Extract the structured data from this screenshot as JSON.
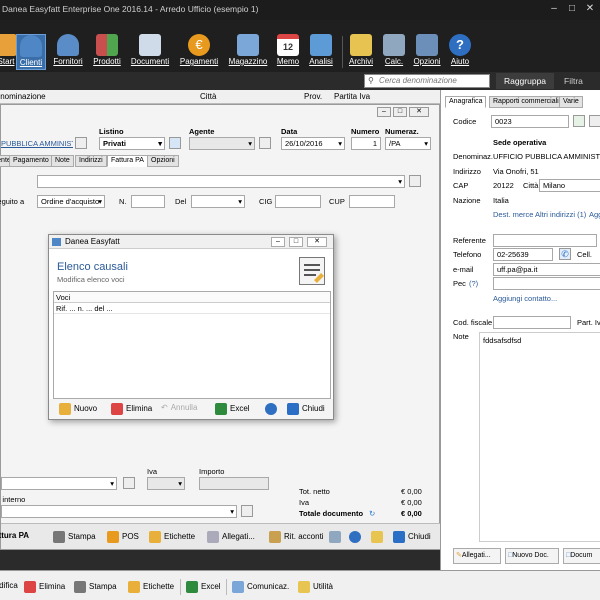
{
  "window": {
    "title": "Danea Easyfatt Enterprise One  2016.14  - Arredo Ufficio (esempio 1)"
  },
  "toolbar": {
    "items": [
      {
        "label": "Start",
        "color": "#e8a13a"
      },
      {
        "label": "Clienti",
        "color": "#4f86c6"
      },
      {
        "label": "Fornitori",
        "color": "#4f86c6"
      },
      {
        "label": "Prodotti",
        "color": "#c94f4f"
      },
      {
        "label": "Documenti",
        "color": "#9fb8d8"
      },
      {
        "label": "Pagamenti",
        "color": "#e89a1e"
      },
      {
        "label": "Magazzino",
        "color": "#7aa6d8"
      },
      {
        "label": "Memo",
        "color": "#d8d8d8"
      },
      {
        "label": "Analisi",
        "color": "#5d9bd6"
      },
      {
        "label": "Archivi",
        "color": "#e7c451"
      },
      {
        "label": "Calc.",
        "color": "#8fa8bf"
      },
      {
        "label": "Opzioni",
        "color": "#6b8fb8"
      },
      {
        "label": "Aiuto",
        "color": "#2f6fc2"
      }
    ],
    "memo_day": "12"
  },
  "search": {
    "placeholder": "Cerca denominazione",
    "group_label": "Raggruppa",
    "filter_label": "Filtra"
  },
  "list_columns": [
    "Denominazione",
    "Città",
    "Prov.",
    "Partita Iva"
  ],
  "edit": {
    "cliente_link": "PUBBLICA AMMINISTRAZIONE",
    "listino_label": "Listino",
    "listino_value": "Privati",
    "agente_label": "Agente",
    "data_label": "Data",
    "data_value": "26/10/2016",
    "numero_label": "Numero",
    "numero_value": "1",
    "numeraz_label": "Numeraz.",
    "numeraz_value": "/PA",
    "tabs": [
      "Cliente",
      "Pagamento",
      "Note",
      "Indirizzi",
      "Fattura PA",
      "Opzioni"
    ],
    "seguito_label": "A seguito a",
    "seguito_value": "Ordine d'acquisto",
    "n_label": "N.",
    "del_label": "Del",
    "cig_label": "CIG",
    "cup_label": "CUP",
    "iva_label": "Iva",
    "importo_label": "Importo",
    "uso_label": "Uso interno",
    "tot_netto_label": "Tot. netto",
    "tot_netto_value": "€ 0,00",
    "iva_tot_label": "Iva",
    "iva_tot_value": "€ 0,00",
    "tot_doc_label": "Totale documento",
    "tot_doc_value": "€ 0,00",
    "bottom_buttons": [
      "Invia fattura PA",
      "Stampa",
      "POS",
      "Etichette",
      "Allegati...",
      "Rit. acconti",
      "",
      "",
      "",
      "Chiudi"
    ]
  },
  "dialog": {
    "title": "Danea Easyfatt",
    "heading": "Elenco causali",
    "subheading": "Modifica elenco voci",
    "list_header": "Voci",
    "rows": [
      "Rif. ... n. ... del ..."
    ],
    "buttons": {
      "new": "Nuovo",
      "delete": "Elimina",
      "undo": "Annulla",
      "excel": "Excel",
      "close": "Chiudi"
    }
  },
  "right": {
    "tabs": [
      "Anagrafica",
      "Rapporti commerciali",
      "Varie"
    ],
    "codice_label": "Codice",
    "codice_value": "0023",
    "sede_label": "Sede operativa",
    "denom_label": "Denominaz.",
    "denom_value": "UFFICIO PUBBLICA AMMINISTRAZIONE",
    "indirizzo_label": "Indirizzo",
    "indirizzo_value": "Via Onofri, 51",
    "cap_label": "CAP",
    "cap_value": "20122",
    "citta_label": "Città",
    "citta_value": "Milano",
    "nazione_label": "Nazione",
    "nazione_value": "Italia",
    "dest_merce": "Dest. merce",
    "altri_indirizzi": "Altri indirizzi (1)",
    "aggiungi": "Aggi",
    "referente_label": "Referente",
    "telefono_label": "Telefono",
    "telefono_value": "02-25639",
    "cell_label": "Cell.",
    "email_label": "e-mail",
    "email_value": "uff.pa@pa.it",
    "pec_label": "Pec",
    "pec_help": "(?)",
    "aggiungi_contatto": "Aggiungi contatto...",
    "codfisc_label": "Cod. fiscale",
    "partiva_label": "Part. Iv",
    "note_label": "Note",
    "note_value": "fddsafsdfsd",
    "btn_allegati": "Allegati...",
    "btn_nuovo_doc": "Nuovo Doc.",
    "btn_documenti": "Docum"
  },
  "statusbar": {
    "items": [
      "Modifica",
      "Elimina",
      "Stampa",
      "Etichette",
      "Excel",
      "Comunicaz.",
      "Utilità"
    ]
  }
}
